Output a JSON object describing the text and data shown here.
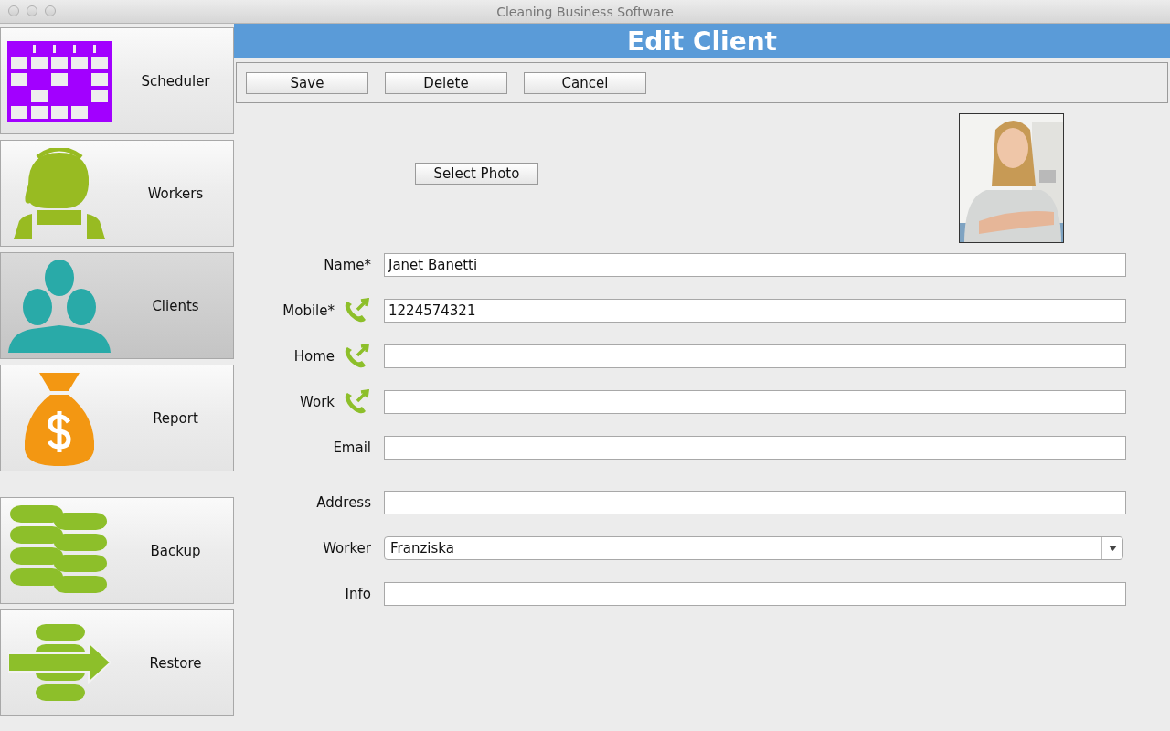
{
  "window": {
    "title": "Cleaning Business Software"
  },
  "sidebar": {
    "items": [
      {
        "label": "Scheduler",
        "kind": "calendar",
        "selected": false
      },
      {
        "label": "Workers",
        "kind": "worker",
        "selected": false
      },
      {
        "label": "Clients",
        "kind": "people",
        "selected": true
      },
      {
        "label": "Report",
        "kind": "money",
        "selected": false
      }
    ],
    "tools": [
      {
        "label": "Backup",
        "kind": "backup",
        "selected": false
      },
      {
        "label": "Restore",
        "kind": "restore",
        "selected": false
      }
    ]
  },
  "header": {
    "title": "Edit Client"
  },
  "toolbar": {
    "buttons": [
      "Save",
      "Delete",
      "Cancel"
    ]
  },
  "photo": {
    "kind": "picture",
    "button": "Select Photo"
  },
  "contact_fields": [
    {
      "label": "Name*",
      "kind": "text",
      "value": "Janet Banetti"
    },
    {
      "label": "Mobile*",
      "kind": "phone",
      "value": "1224574321"
    },
    {
      "label": "Home",
      "kind": "phone"
    },
    {
      "label": "Work",
      "kind": "phone"
    },
    {
      "label": "Email",
      "kind": "text"
    }
  ],
  "other_fields": [
    {
      "label": "Address",
      "kind": "text"
    },
    {
      "label": "Worker",
      "kind": "select",
      "value": "Franziska"
    },
    {
      "label": "Info",
      "kind": "text"
    }
  ]
}
